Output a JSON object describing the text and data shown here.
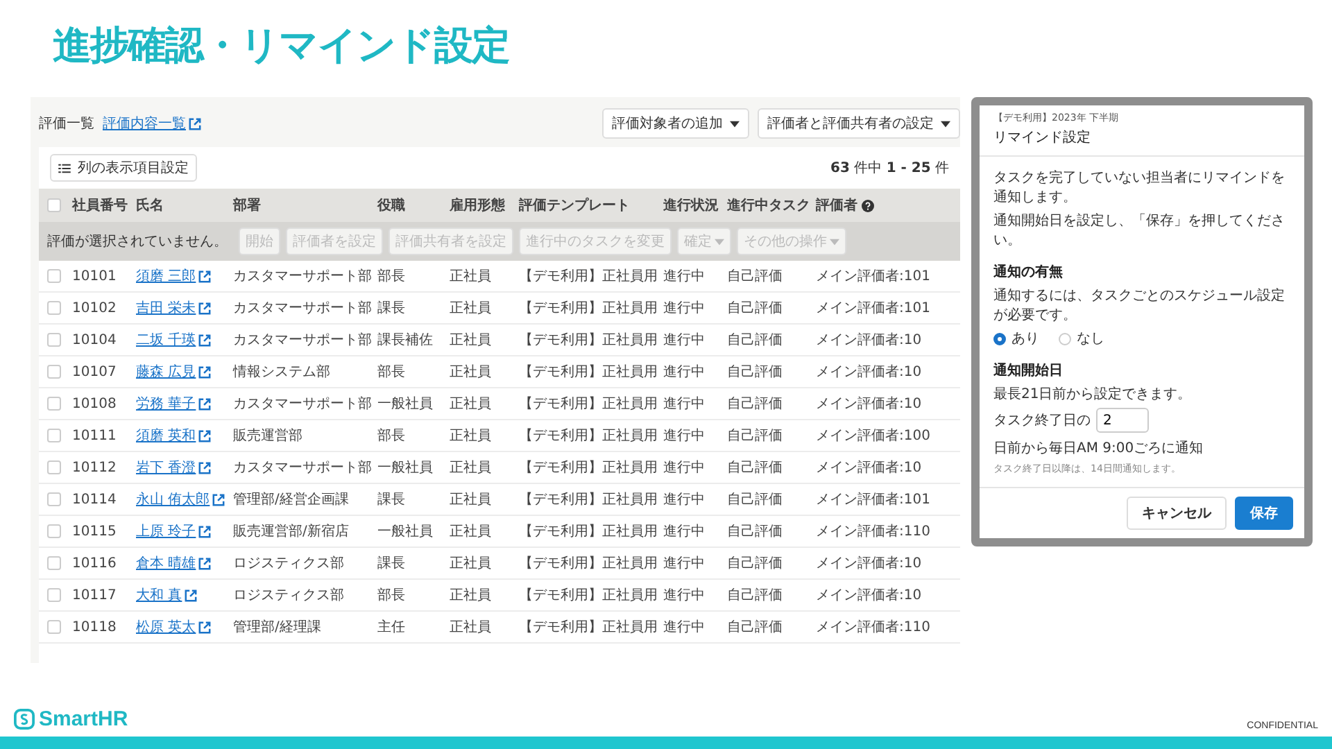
{
  "slide_title": "進捗確認・リマインド設定",
  "evaluation_list": {
    "heading": "評価一覧",
    "link": "評価内容一覧",
    "header_buttons": [
      "評価対象者の追加",
      "評価者と評価共有者の設定"
    ],
    "column_settings_button": "列の表示項目設定",
    "pagination": "**63** 件中 **1 - 25** 件",
    "select_all": {
      "checked": false
    },
    "columns": [
      "社員番号",
      "氏名",
      "部署",
      "役職",
      "雇用形態",
      "評価テンプレート",
      "進行状況",
      "進行中タスク",
      "評価者"
    ],
    "selection_bar": {
      "message": "評価が選択されていません。",
      "actions": [
        {
          "label": "開始",
          "dropdown": false
        },
        {
          "label": "評価者を設定",
          "dropdown": false
        },
        {
          "label": "評価共有者を設定",
          "dropdown": false
        },
        {
          "label": "進行中のタスクを変更",
          "dropdown": false
        },
        {
          "label": "確定",
          "dropdown": true
        },
        {
          "label": "その他の操作",
          "dropdown": true
        }
      ]
    },
    "rows": [
      {
        "checked": false,
        "cells": [
          "10101",
          "須磨 三郎",
          "カスタマーサポート部",
          "部長",
          "正社員",
          "【デモ利用】正社員用",
          "進行中",
          "自己評価",
          "メイン評価者:101"
        ]
      },
      {
        "checked": false,
        "cells": [
          "10102",
          "吉田 栄未",
          "カスタマーサポート部",
          "課長",
          "正社員",
          "【デモ利用】正社員用",
          "進行中",
          "自己評価",
          "メイン評価者:101"
        ]
      },
      {
        "checked": false,
        "cells": [
          "10104",
          "二坂 千瑛",
          "カスタマーサポート部",
          "課長補佐",
          "正社員",
          "【デモ利用】正社員用",
          "進行中",
          "自己評価",
          "メイン評価者:10"
        ]
      },
      {
        "checked": false,
        "cells": [
          "10107",
          "藤森 広見",
          "情報システム部",
          "部長",
          "正社員",
          "【デモ利用】正社員用",
          "進行中",
          "自己評価",
          "メイン評価者:10"
        ]
      },
      {
        "checked": false,
        "cells": [
          "10108",
          "労務 華子",
          "カスタマーサポート部",
          "一般社員",
          "正社員",
          "【デモ利用】正社員用",
          "進行中",
          "自己評価",
          "メイン評価者:10"
        ]
      },
      {
        "checked": false,
        "cells": [
          "10111",
          "須磨 英和",
          "販売運営部",
          "部長",
          "正社員",
          "【デモ利用】正社員用",
          "進行中",
          "自己評価",
          "メイン評価者:100"
        ]
      },
      {
        "checked": false,
        "cells": [
          "10112",
          "岩下 香澄",
          "カスタマーサポート部",
          "一般社員",
          "正社員",
          "【デモ利用】正社員用",
          "進行中",
          "自己評価",
          "メイン評価者:10"
        ]
      },
      {
        "checked": false,
        "cells": [
          "10114",
          "永山 侑太郎",
          "管理部/経営企画課",
          "課長",
          "正社員",
          "【デモ利用】正社員用",
          "進行中",
          "自己評価",
          "メイン評価者:101"
        ]
      },
      {
        "checked": false,
        "cells": [
          "10115",
          "上原 玲子",
          "販売運営部/新宿店",
          "一般社員",
          "正社員",
          "【デモ利用】正社員用",
          "進行中",
          "自己評価",
          "メイン評価者:110"
        ]
      },
      {
        "checked": false,
        "cells": [
          "10116",
          "倉本 晴雄",
          "ロジスティクス部",
          "課長",
          "正社員",
          "【デモ利用】正社員用",
          "進行中",
          "自己評価",
          "メイン評価者:10"
        ]
      },
      {
        "checked": false,
        "cells": [
          "10117",
          "大和 真",
          "ロジスティクス部",
          "部長",
          "正社員",
          "【デモ利用】正社員用",
          "進行中",
          "自己評価",
          "メイン評価者:10"
        ]
      },
      {
        "checked": false,
        "cells": [
          "10118",
          "松原 英太",
          "管理部/経理課",
          "主任",
          "正社員",
          "【デモ利用】正社員用",
          "進行中",
          "自己評価",
          "メイン評価者:110"
        ]
      }
    ]
  },
  "dialog": {
    "caption": "【デモ利用】2023年 下半期",
    "title": "リマインド設定",
    "intro_lines": [
      "タスクを完了していない担当者にリマインドを通知します。",
      "通知開始日を設定し、「保存」を押してください。"
    ],
    "notification": {
      "label": "通知の有無",
      "hint": "通知するには、タスクごとのスケジュール設定が必要です。",
      "options": [
        {
          "label": "あり",
          "selected": true
        },
        {
          "label": "なし",
          "selected": false
        }
      ]
    },
    "start_day": {
      "label": "通知開始日",
      "hint": "最長21日前から設定できます。",
      "prefix": "タスク終了日の",
      "value": "2",
      "suffix": "日前から毎日AM 9:00ごろに通知",
      "note": "タスク終了日以降は、14日間通知します。"
    },
    "buttons": [
      {
        "label": "キャンセル",
        "kind": "secondary"
      },
      {
        "label": "保存",
        "kind": "primary"
      }
    ]
  },
  "footer": {
    "logo": "SmartHR",
    "confidential": "CONFIDENTIAL"
  }
}
